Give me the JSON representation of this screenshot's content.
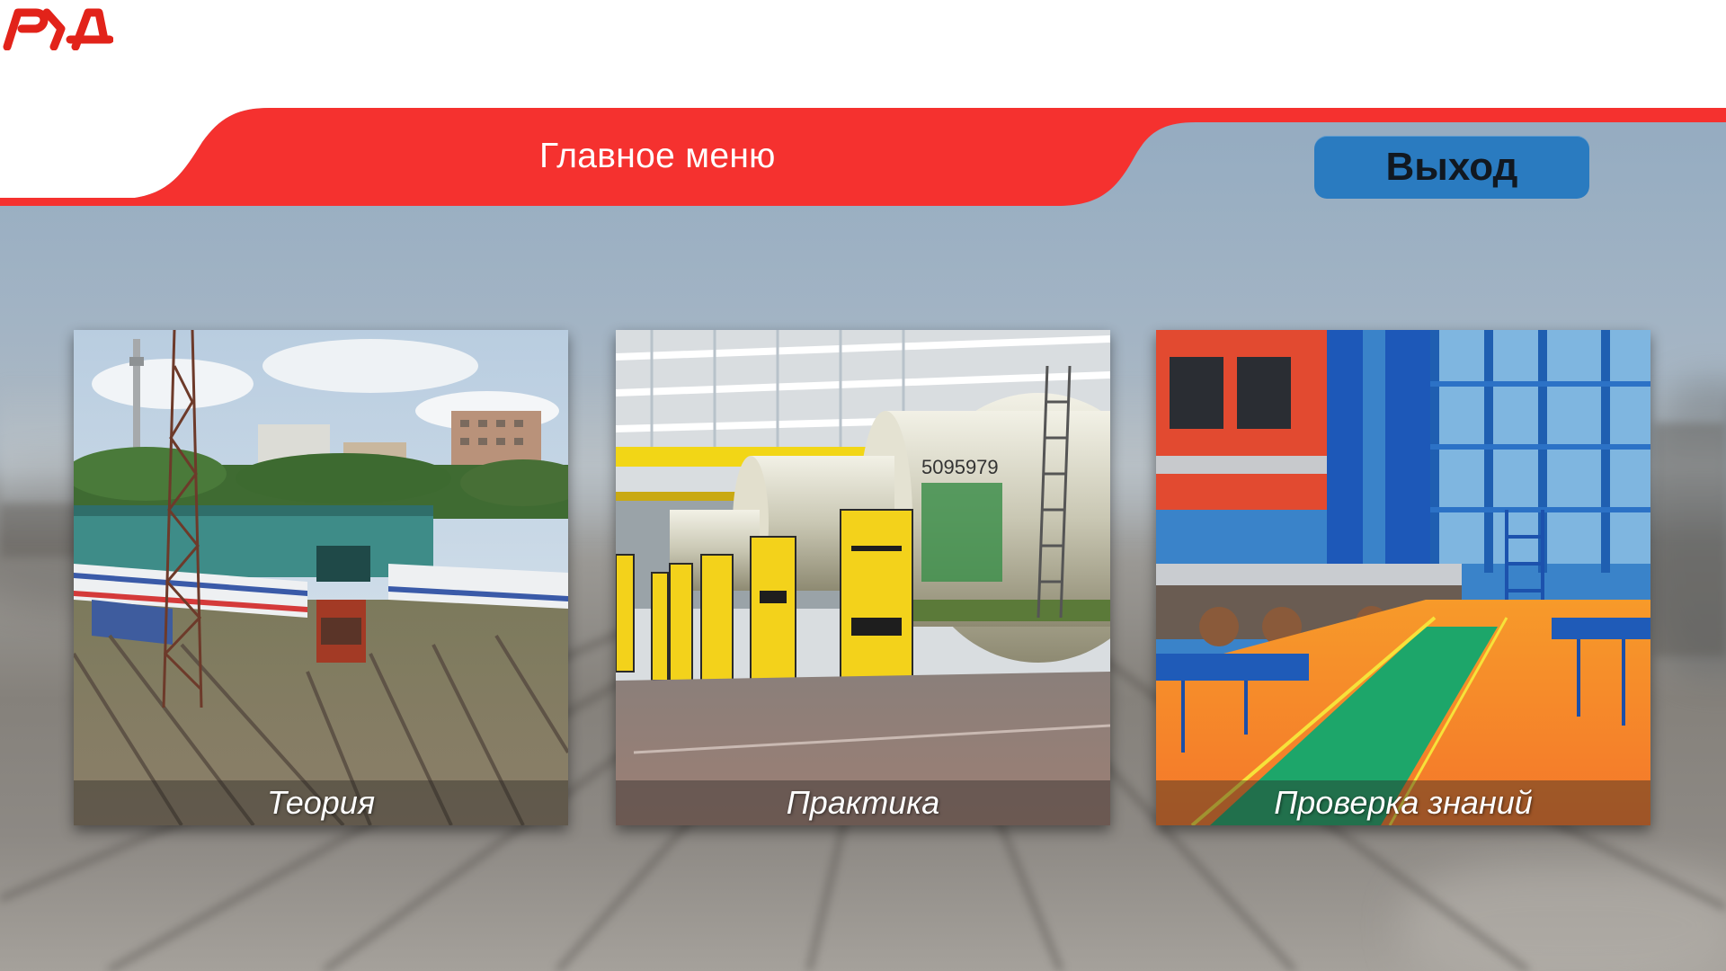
{
  "app": {
    "brand": "РЖД",
    "colors": {
      "accent_red": "#f5312f",
      "exit_button": "#2a7bc0"
    }
  },
  "header": {
    "title": "Главное меню",
    "exit_label": "Выход",
    "logo_icon": "rzd-logo-icon"
  },
  "menu": {
    "items": [
      {
        "label": "Теория",
        "image": "rail-yard-with-trains-photo"
      },
      {
        "label": "Практика",
        "image": "tank-cars-on-yellow-lifts-photo"
      },
      {
        "label": "Проверка знаний",
        "image": "train-repair-depot-photo"
      }
    ]
  }
}
